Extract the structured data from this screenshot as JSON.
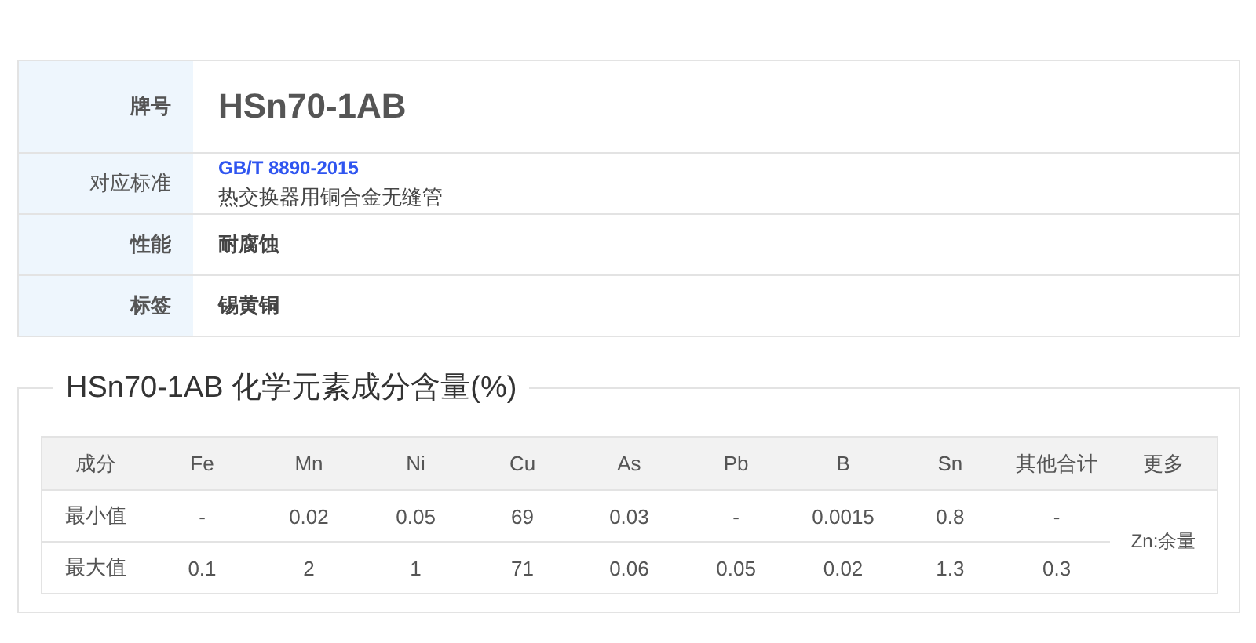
{
  "info": [
    {
      "label": "牌号",
      "kind": "grade",
      "value": "HSn70-1AB"
    },
    {
      "label": "对应标准",
      "kind": "standard",
      "link": "GB/T 8890-2015",
      "value": "热交换器用铜合金无缝管"
    },
    {
      "label": "性能",
      "kind": "plain",
      "value": "耐腐蚀"
    },
    {
      "label": "标签",
      "kind": "plain",
      "value": "锡黄铜"
    }
  ],
  "composition": {
    "title": "HSn70-1AB 化学元素成分含量(%)",
    "columns": [
      "成分",
      "Fe",
      "Mn",
      "Ni",
      "Cu",
      "As",
      "Pb",
      "B",
      "Sn",
      "其他合计",
      "更多"
    ],
    "rows": [
      [
        "最小值",
        "-",
        "0.02",
        "0.05",
        "69",
        "0.03",
        "-",
        "0.0015",
        "0.8",
        "-"
      ],
      [
        "最大值",
        "0.1",
        "2",
        "1",
        "71",
        "0.06",
        "0.05",
        "0.02",
        "1.3",
        "0.3"
      ]
    ],
    "more": "Zn:余量"
  }
}
